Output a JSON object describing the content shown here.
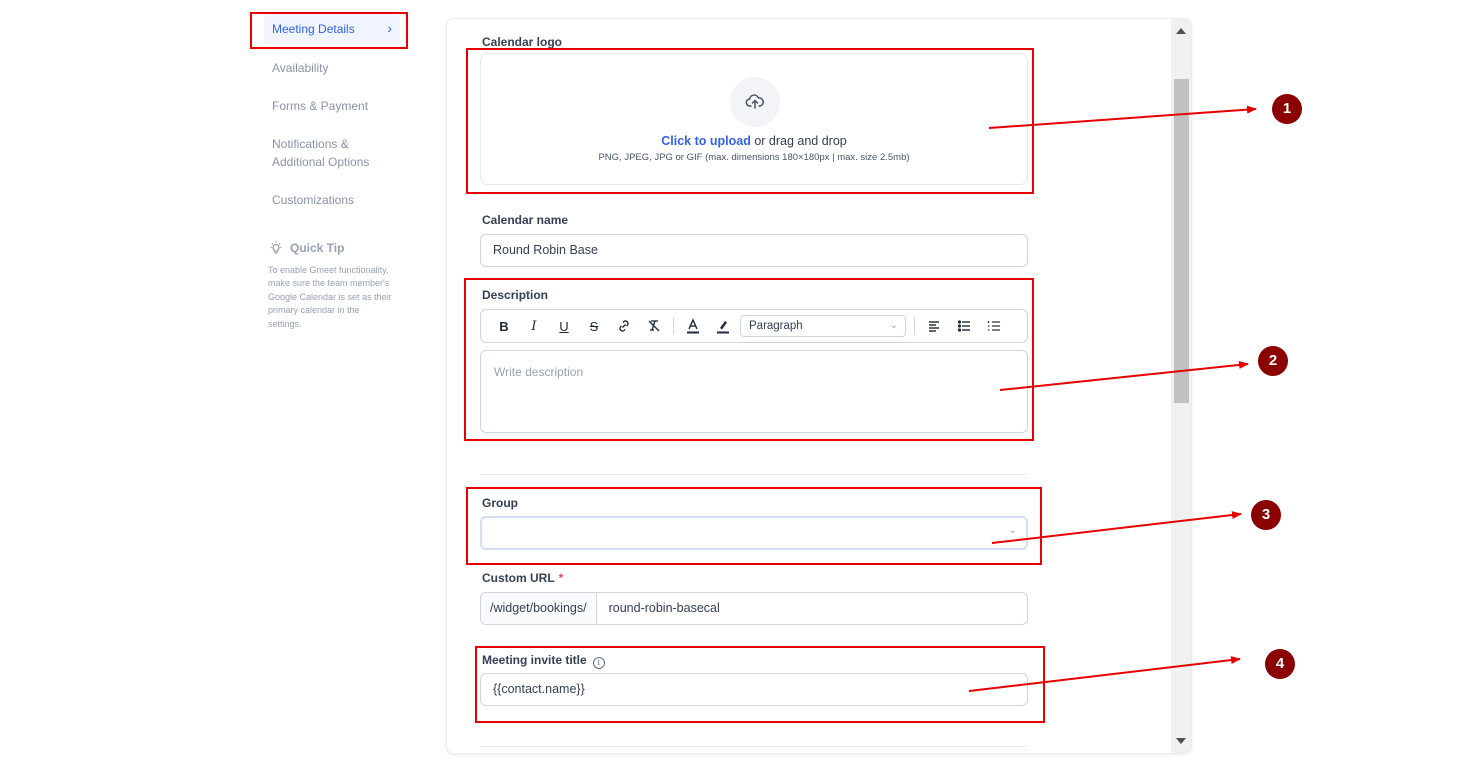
{
  "sidebar": {
    "items": [
      {
        "label": "Meeting Details",
        "active": true
      },
      {
        "label": "Availability"
      },
      {
        "label": "Forms & Payment"
      },
      {
        "label": "Notifications & Additional Options"
      },
      {
        "label": "Customizations"
      }
    ],
    "quick_tip": {
      "title": "Quick Tip",
      "text": "To enable Gmeet functionality, make sure the team member's Google Calendar is set as their primary calendar in the settings."
    }
  },
  "form": {
    "calendar_logo": {
      "label": "Calendar logo",
      "upload_link": "Click to upload",
      "upload_text": " or drag and drop",
      "hint": "PNG, JPEG, JPG or GIF (max. dimensions 180×180px | max. size 2.5mb)"
    },
    "calendar_name": {
      "label": "Calendar name",
      "value": "Round Robin Base"
    },
    "description": {
      "label": "Description",
      "placeholder": "Write description",
      "toolbar": {
        "bold": "B",
        "italic": "I",
        "underline": "U",
        "strike": "S",
        "paragraph": "Paragraph"
      }
    },
    "group": {
      "label": "Group",
      "value": ""
    },
    "custom_url": {
      "label": "Custom URL",
      "required_mark": "*",
      "prefix": "/widget/bookings/",
      "value": "round-robin-basecal"
    },
    "meeting_invite_title": {
      "label": "Meeting invite title",
      "value": "{{contact.name}}"
    }
  },
  "annotations": [
    "1",
    "2",
    "3",
    "4"
  ],
  "colors": {
    "accent": "#3562e6",
    "annotation_red": "#e60000",
    "badge": "#8b0000"
  }
}
